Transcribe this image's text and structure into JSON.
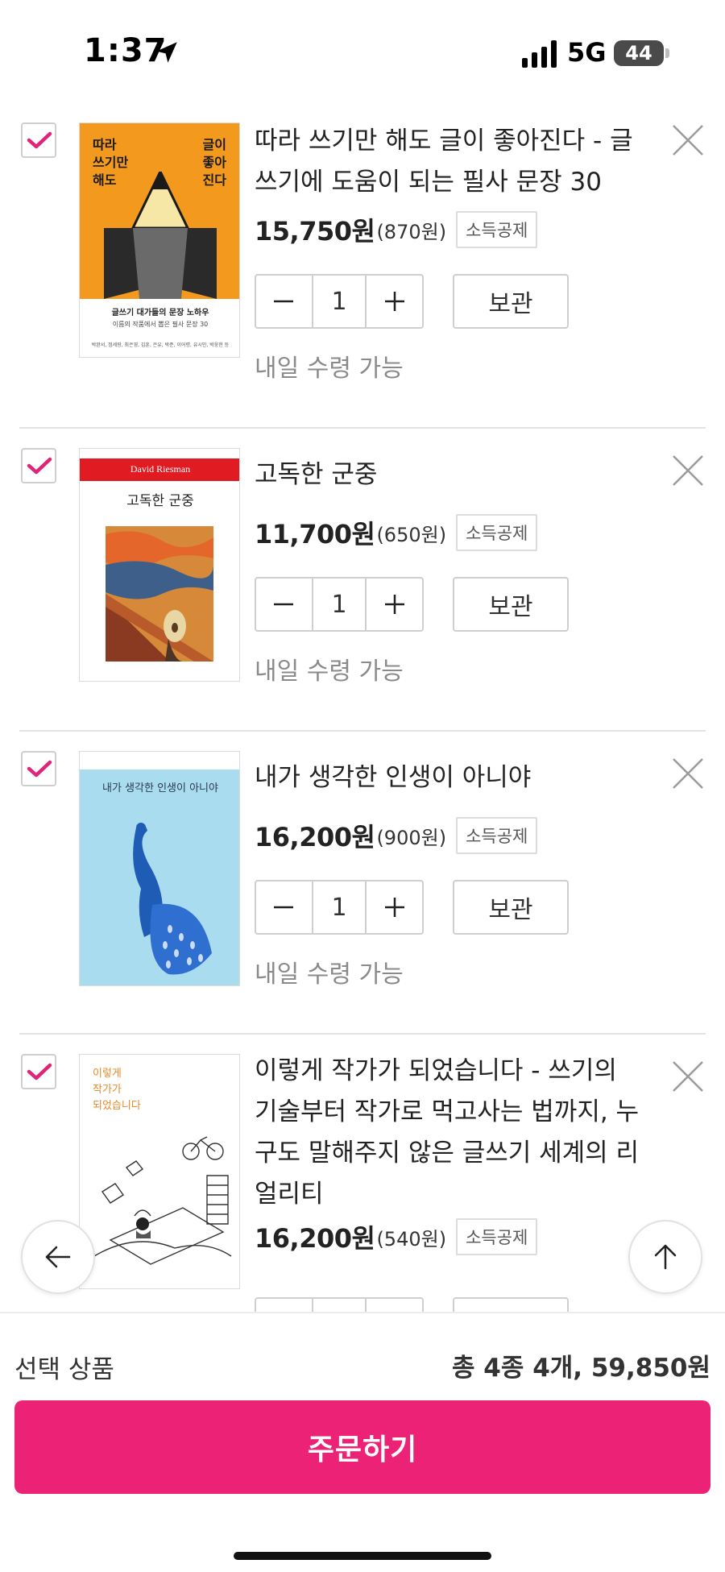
{
  "status_bar": {
    "time": "1:37",
    "network": "5G",
    "battery": "44"
  },
  "colors": {
    "accent": "#ec2276",
    "check": "#e0247a",
    "divider": "#e2e2e2"
  },
  "cart_items": [
    {
      "title": "따라 쓰기만 해도 글이 좋아진다 - 글쓰기에 도움이 되는 필사 문장 30",
      "price": "15,750원",
      "points": "(870원)",
      "tax_badge": "소득공제",
      "quantity": "1",
      "save_label": "보관",
      "delivery": "내일 수령 가능",
      "checked": true,
      "cover": {
        "title_left": "따라\n쓰기만\n해도",
        "title_right": "글이\n좋아\n진다",
        "banner": "글쓰기 대가들의 문장 노하우",
        "sub": "이름의 작품에서 뽑은 필사 문장 30",
        "authors": "박완서, 정세랑, 최은영, 김훈, 은유, 박준, 이어령, 유시민, 박웅현 등"
      }
    },
    {
      "title": "고독한 군중",
      "price": "11,700원",
      "points": "(650원)",
      "tax_badge": "소득공제",
      "quantity": "1",
      "save_label": "보관",
      "delivery": "내일 수령 가능",
      "checked": true,
      "cover": {
        "author": "David Riesman",
        "title": "고독한 군중"
      }
    },
    {
      "title": "내가 생각한 인생이 아니야",
      "price": "16,200원",
      "points": "(900원)",
      "tax_badge": "소득공제",
      "quantity": "1",
      "save_label": "보관",
      "delivery": "내일 수령 가능",
      "checked": true,
      "cover": {
        "title": "내가 생각한 인생이 아니야"
      }
    },
    {
      "title": "이렇게 작가가 되었습니다 - 쓰기의 기술부터 작가로 먹고사는 법까지, 누구도 말해주지 않은 글쓰기 세계의 리얼리티",
      "price": "16,200원",
      "points": "(540원)",
      "tax_badge": "소득공제",
      "checked": true,
      "cover": {
        "title": "이렇게\n작가가\n되었습니다"
      }
    }
  ],
  "summary": {
    "selected_label": "선택 상품",
    "total": "총 4종 4개, 59,850원"
  },
  "order_button": "주문하기",
  "icons": {
    "check": "checkmark-icon",
    "close": "close-x-icon",
    "minus": "minus-icon",
    "plus": "plus-icon",
    "back": "arrow-left-icon",
    "top": "arrow-up-icon"
  }
}
